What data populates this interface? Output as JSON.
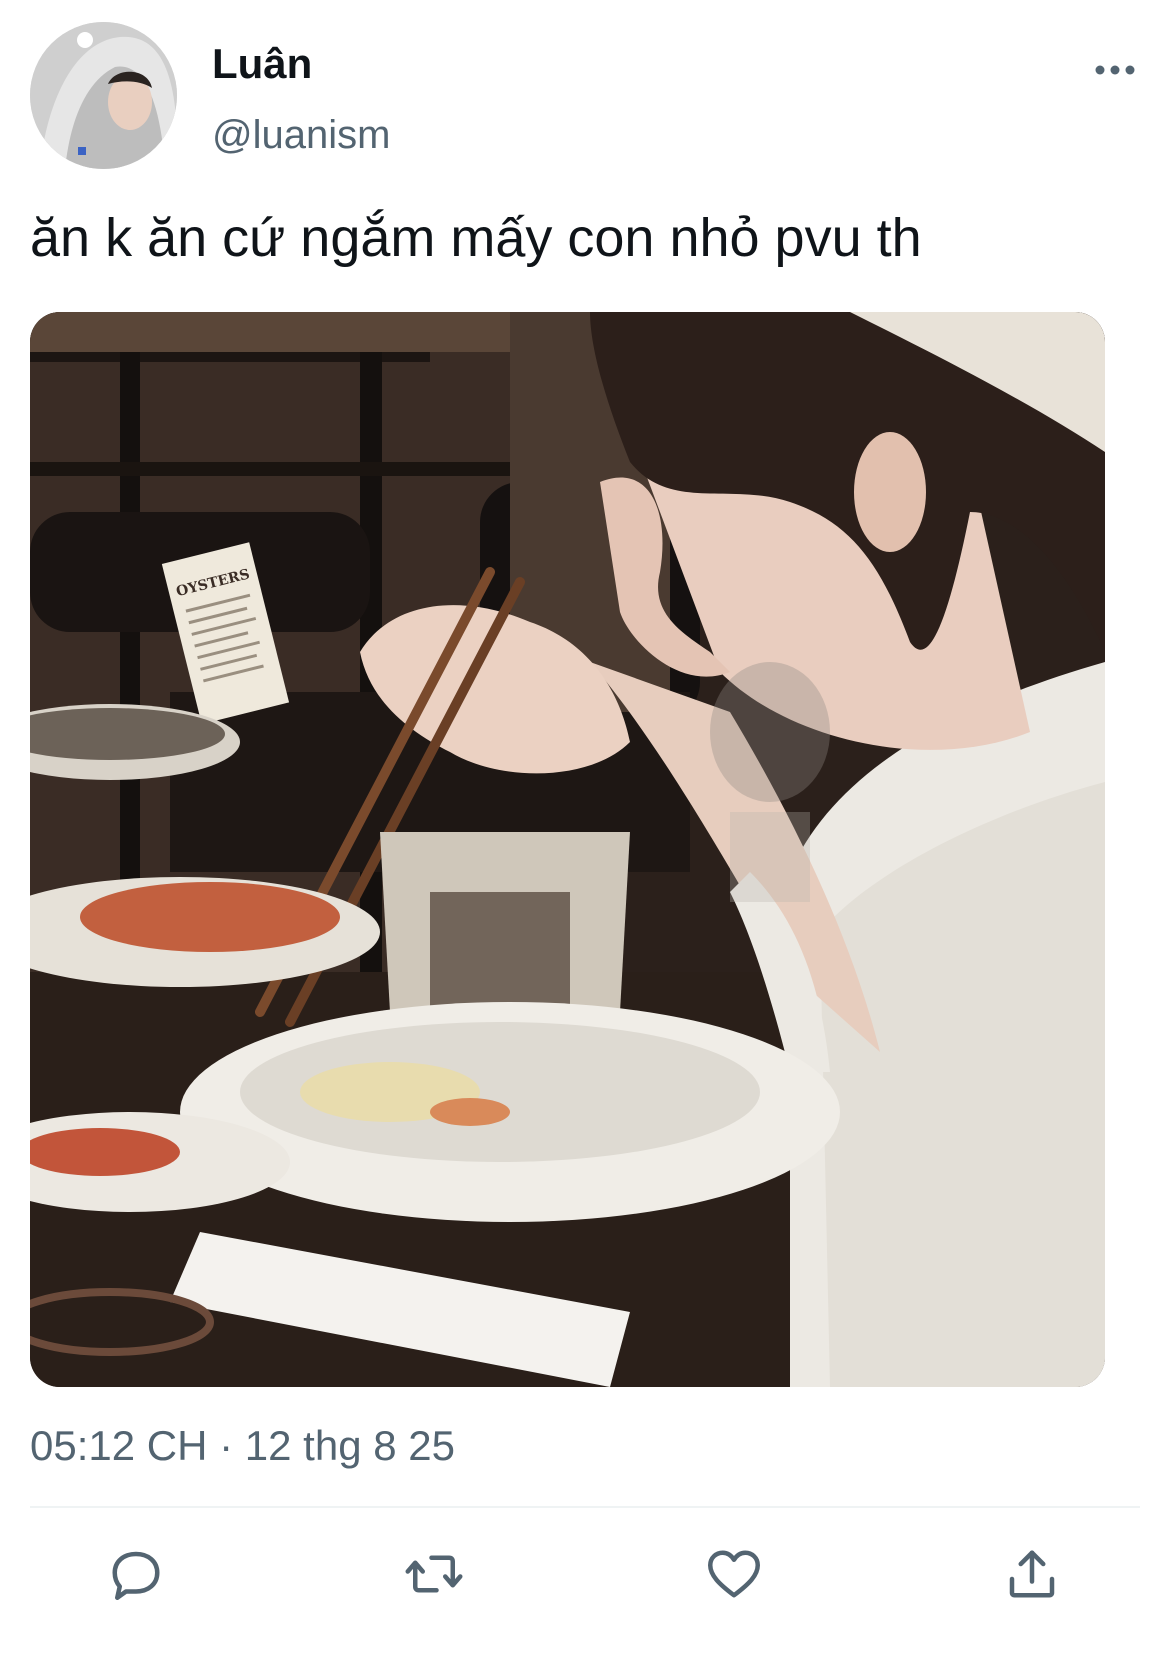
{
  "tweet": {
    "author": {
      "display_name": "Luân",
      "handle": "@luanism"
    },
    "text": "ăn k ăn cứ ngắm mấy con nhỏ pvu th",
    "media": {
      "menu_card_text": "OYSTERS"
    },
    "time": "05:12 CH",
    "separator": "·",
    "date": "12 thg 8 25"
  },
  "icons": {
    "more": "more-horizontal-icon",
    "reply": "reply-icon",
    "retweet": "retweet-icon",
    "like": "heart-icon",
    "share": "share-icon"
  },
  "colors": {
    "text_primary": "#0f1419",
    "text_secondary": "#536471",
    "icon": "#536471",
    "divider": "#eff3f4"
  }
}
